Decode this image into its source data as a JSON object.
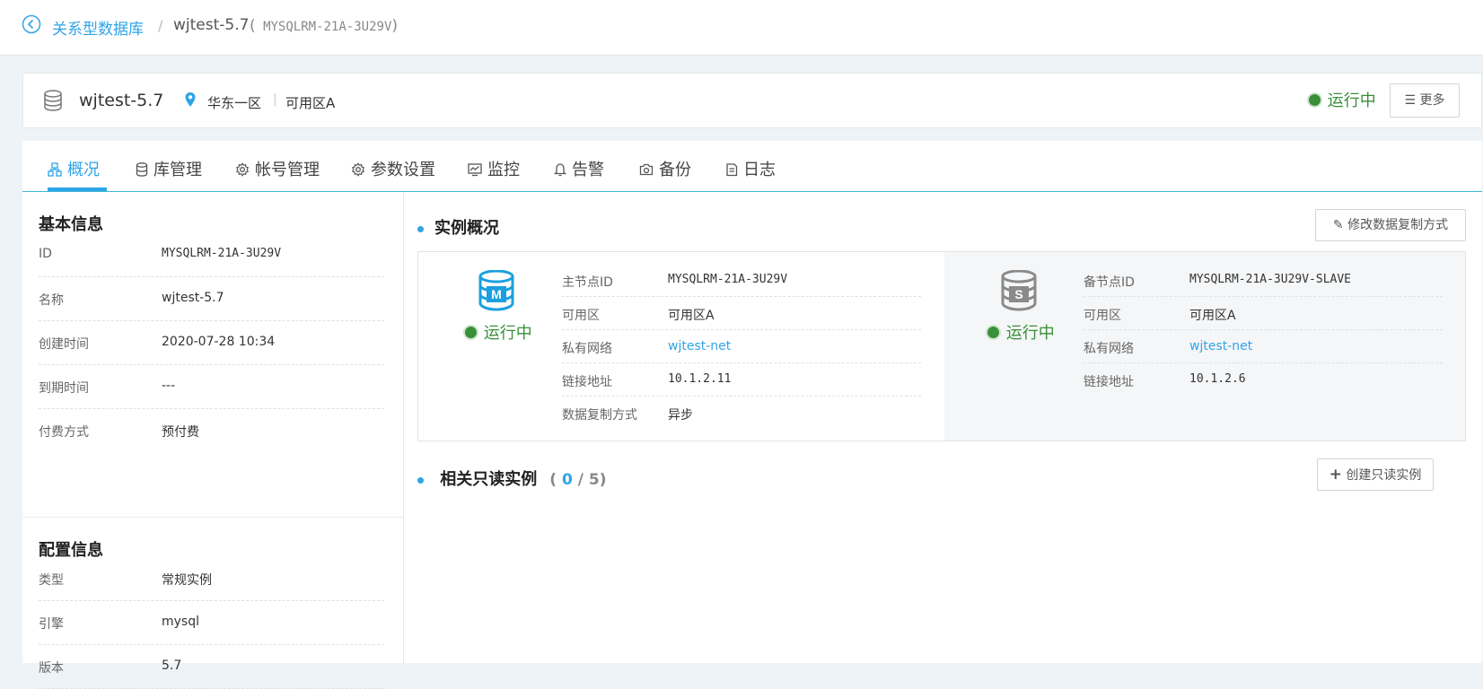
{
  "breadcrumb": {
    "root": "关系型数据库",
    "separator": "/",
    "current": "wjtest-5.7",
    "open_paren": "(",
    "id": "MYSQLRM-21A-3U29V",
    "close_paren": ")"
  },
  "header": {
    "name": "wjtest-5.7",
    "region": "华东一区",
    "separator": "|",
    "zone": "可用区A",
    "status": "运行中",
    "more_label": "更多"
  },
  "tabs": [
    {
      "label": "概况",
      "icon": "overview-icon"
    },
    {
      "label": "库管理",
      "icon": "database-icon"
    },
    {
      "label": "帐号管理",
      "icon": "gear-icon"
    },
    {
      "label": "参数设置",
      "icon": "gear-icon"
    },
    {
      "label": "监控",
      "icon": "monitor-icon"
    },
    {
      "label": "告警",
      "icon": "bell-icon"
    },
    {
      "label": "备份",
      "icon": "camera-icon"
    },
    {
      "label": "日志",
      "icon": "log-icon"
    }
  ],
  "basic_info": {
    "title": "基本信息",
    "rows": [
      {
        "key": "ID",
        "value": "MYSQLRM-21A-3U29V"
      },
      {
        "key": "名称",
        "value": "wjtest-5.7"
      },
      {
        "key": "创建时间",
        "value": "2020-07-28 10:34"
      },
      {
        "key": "到期时间",
        "value": "---"
      },
      {
        "key": "付费方式",
        "value": "预付费"
      }
    ]
  },
  "config_info": {
    "title": "配置信息",
    "rows": [
      {
        "key": "类型",
        "value": "常规实例"
      },
      {
        "key": "引擎",
        "value": "mysql"
      },
      {
        "key": "版本",
        "value": "5.7"
      }
    ]
  },
  "instance_overview": {
    "title": "实例概况",
    "edit_label": "修改数据复制方式",
    "master": {
      "badge": "M",
      "status": "运行中",
      "rows": [
        {
          "key": "主节点ID",
          "value": "MYSQLRM-21A-3U29V"
        },
        {
          "key": "可用区",
          "value": "可用区A"
        },
        {
          "key": "私有网络",
          "value": "wjtest-net"
        },
        {
          "key": "链接地址",
          "value": "10.1.2.11"
        },
        {
          "key": "数据复制方式",
          "value": "异步"
        }
      ]
    },
    "slave": {
      "badge": "S",
      "status": "运行中",
      "rows": [
        {
          "key": "备节点ID",
          "value": "MYSQLRM-21A-3U29V-SLAVE"
        },
        {
          "key": "可用区",
          "value": "可用区A"
        },
        {
          "key": "私有网络",
          "value": "wjtest-net"
        },
        {
          "key": "链接地址",
          "value": "10.1.2.6"
        }
      ]
    }
  },
  "readonly": {
    "title": "相关只读实例",
    "open_paren": "(",
    "count": "0",
    "total": "/ 5",
    "close_paren": ")",
    "create_label": "创建只读实例"
  },
  "colors": {
    "accent": "#2fa4e7",
    "running": "#3a8f3a"
  }
}
